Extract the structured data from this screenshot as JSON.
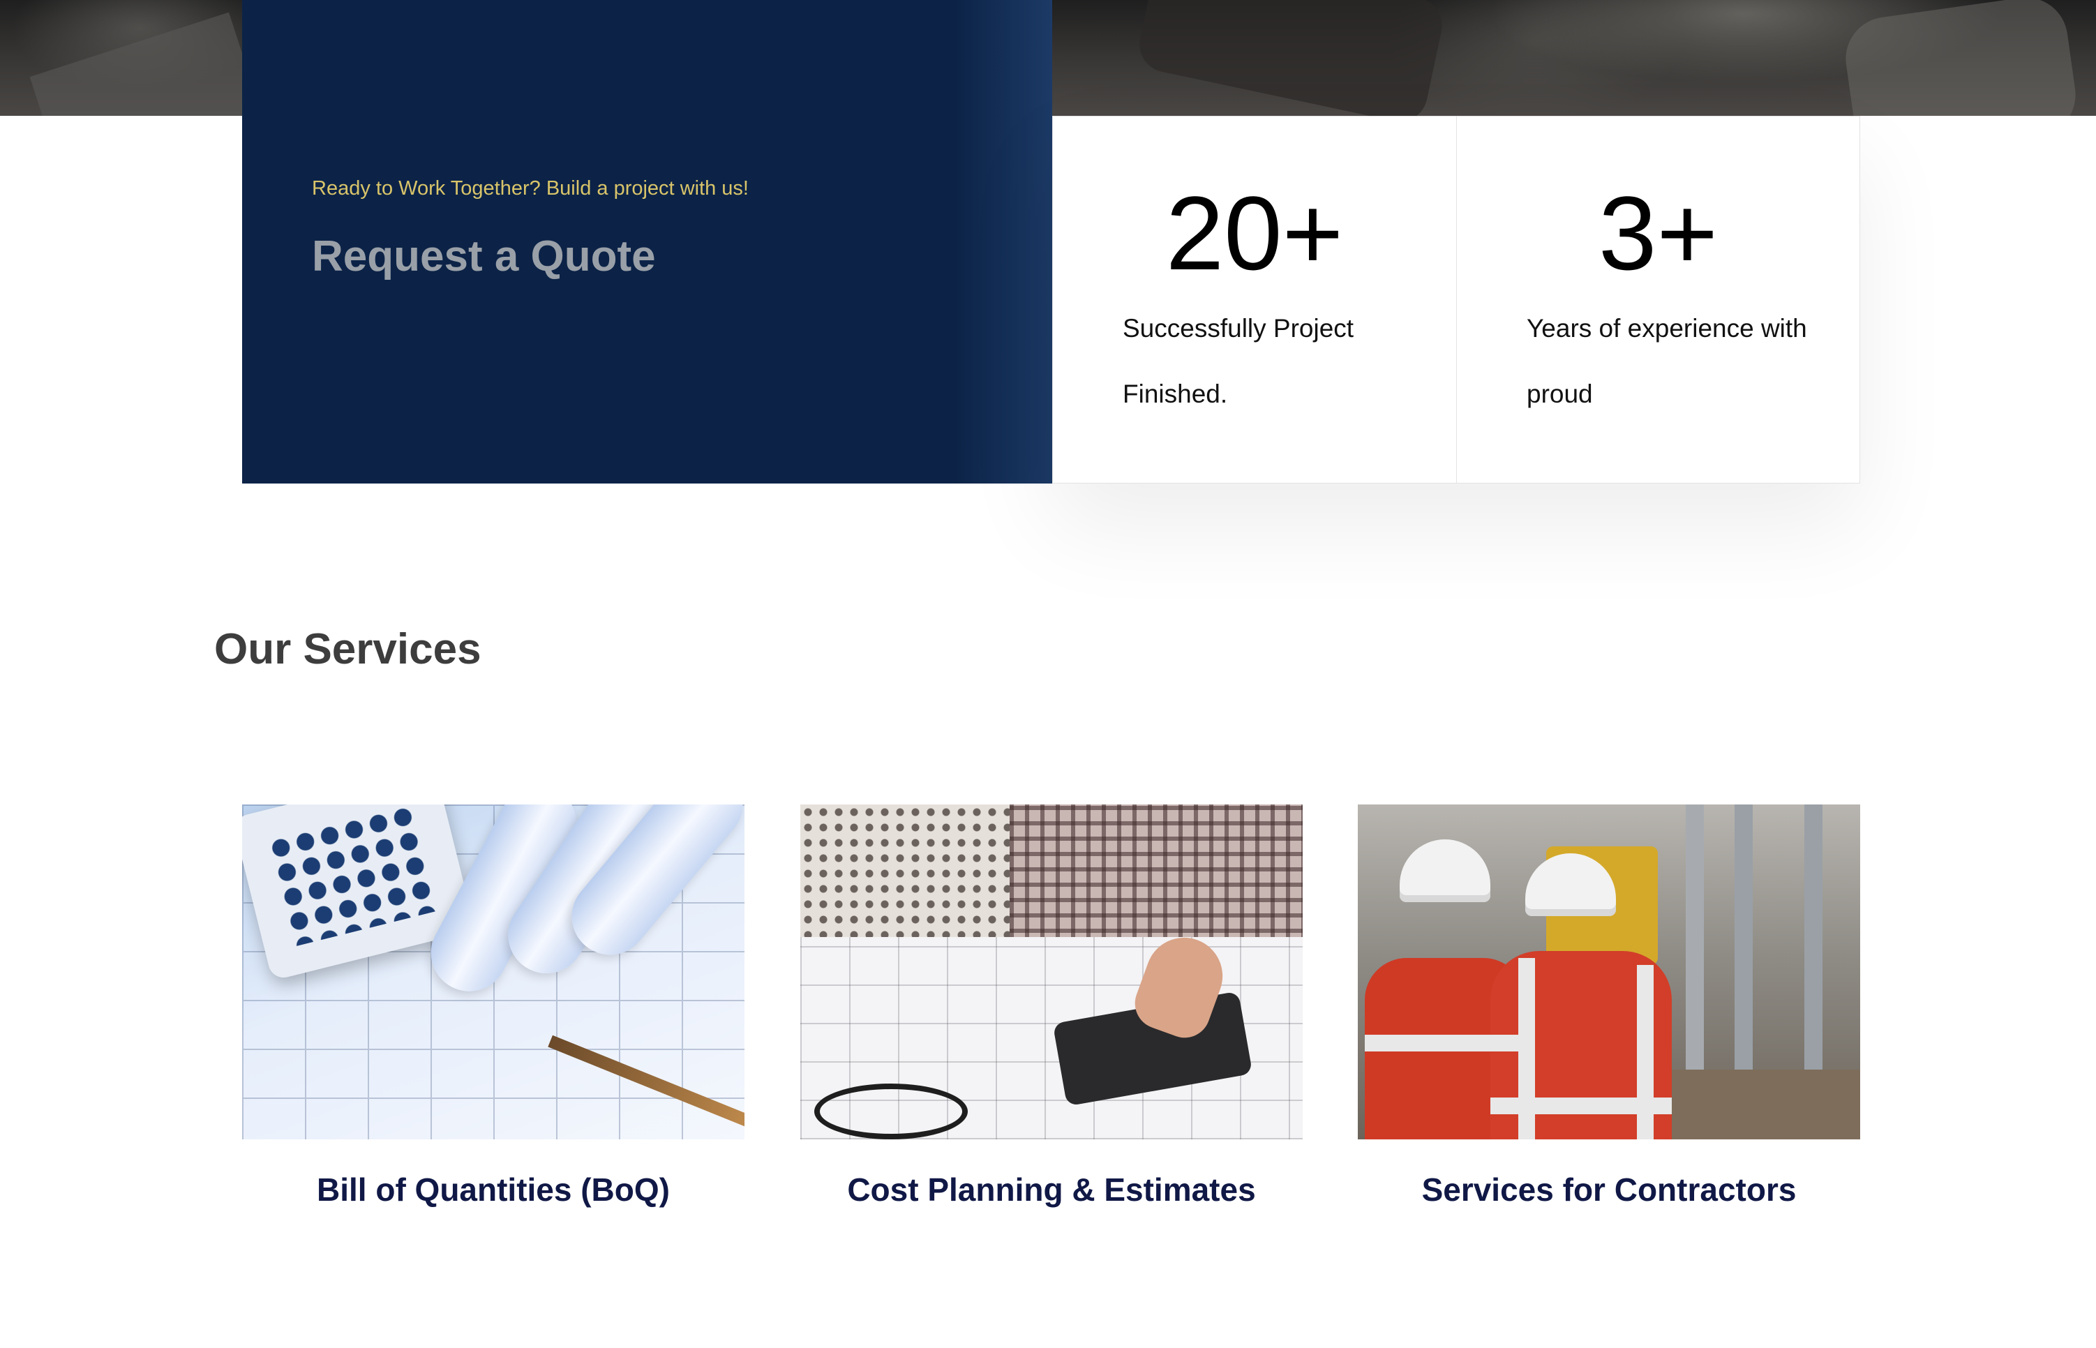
{
  "quote": {
    "tagline": "Ready to Work Together? Build a project with us!",
    "title": "Request a Quote"
  },
  "stats": [
    {
      "number": "20+",
      "label": "Successfully Project Finished."
    },
    {
      "number": "3+",
      "label": "Years of experience with proud"
    }
  ],
  "services": {
    "title": "Our Services",
    "items": [
      {
        "name": "Bill of Quantities (BoQ)",
        "image": "blueprint-calculator-image"
      },
      {
        "name": "Cost Planning & Estimates",
        "image": "people-calculating-image"
      },
      {
        "name": "Services for Contractors",
        "image": "construction-workers-image"
      }
    ]
  },
  "colors": {
    "panel": "#0c2347",
    "tagline": "#d9c46a",
    "service_name": "#101846"
  }
}
